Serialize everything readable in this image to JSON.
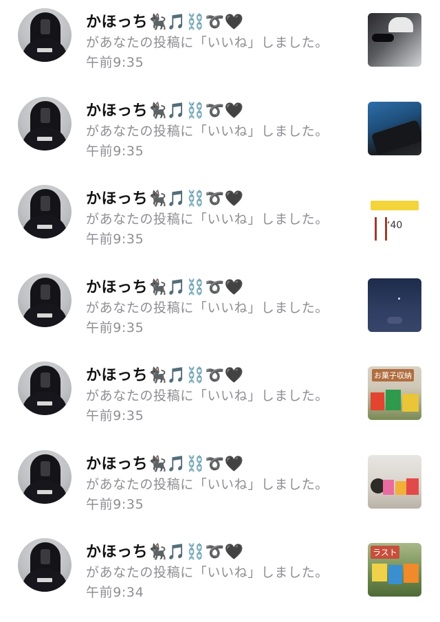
{
  "notifications": [
    {
      "name": "かほっち🐈‍⬛🎵⛓️➰🖤",
      "message": "があなたの投稿に「いいね」しました。 午前9:35",
      "thumb": "t1"
    },
    {
      "name": "かほっち🐈‍⬛🎵⛓️➰🖤",
      "message": "があなたの投稿に「いいね」しました。 午前9:35",
      "thumb": "t2"
    },
    {
      "name": "かほっち🐈‍⬛🎵⛓️➰🖤",
      "message": "があなたの投稿に「いいね」しました。 午前9:35",
      "thumb": "t3"
    },
    {
      "name": "かほっち🐈‍⬛🎵⛓️➰🖤",
      "message": "があなたの投稿に「いいね」しました。 午前9:35",
      "thumb": "t4"
    },
    {
      "name": "かほっち🐈‍⬛🎵⛓️➰🖤",
      "message": "があなたの投稿に「いいね」しました。 午前9:35",
      "thumb": "t5"
    },
    {
      "name": "かほっち🐈‍⬛🎵⛓️➰🖤",
      "message": "があなたの投稿に「いいね」しました。 午前9:35",
      "thumb": "t6"
    },
    {
      "name": "かほっち🐈‍⬛🎵⛓️➰🖤",
      "message": "があなたの投稿に「いいね」しました。 午前9:34",
      "thumb": "t7"
    }
  ],
  "thumb_labels": {
    "t3_text": "ʻ40",
    "t5_title": "お菓子収納",
    "t7_title": "ラスト"
  }
}
